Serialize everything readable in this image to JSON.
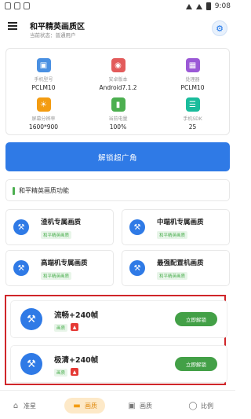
{
  "status_bar": {
    "time": "9:08"
  },
  "app_bar": {
    "title": "和平精英画质区",
    "subtitle": "当前状态：普通用户"
  },
  "device_info": [
    {
      "label": "手机型号",
      "value": "PCLM10",
      "icon": "phone-icon",
      "color": "#4a90e2"
    },
    {
      "label": "安卓版本",
      "value": "Android7.1.2",
      "icon": "android-icon",
      "color": "#e35b5b"
    },
    {
      "label": "处理器",
      "value": "PCLM10",
      "icon": "cpu-icon",
      "color": "#9b59d6"
    },
    {
      "label": "屏幕分辨率",
      "value": "1600*900",
      "icon": "screen-icon",
      "color": "#f39c12"
    },
    {
      "label": "当前电量",
      "value": "100%",
      "icon": "battery-icon",
      "color": "#4caf50"
    },
    {
      "label": "手机SDK",
      "value": "25",
      "icon": "sdk-icon",
      "color": "#1abc9c"
    }
  ],
  "unlock_main_label": "解锁超广角",
  "section_title": "和平精英画质功能",
  "quality_cards": [
    {
      "title": "渣机专属画质",
      "badge": "和平精英画质"
    },
    {
      "title": "中端机专属画质",
      "badge": "和平精英画质"
    },
    {
      "title": "高端机专属画质",
      "badge": "和平精英画质"
    },
    {
      "title": "最强配置机画质",
      "badge": "和平精英画质"
    }
  ],
  "premium_items": [
    {
      "title": "流畅+240帧",
      "badge": "画质",
      "button": "立即解锁"
    },
    {
      "title": "极清+240帧",
      "badge": "画质",
      "button": "立即解锁"
    }
  ],
  "bottom_nav": [
    {
      "label": "准星",
      "icon": "home-icon"
    },
    {
      "label": "画质",
      "icon": "quality-icon",
      "active": true
    },
    {
      "label": "画质",
      "icon": "image-icon"
    },
    {
      "label": "比例",
      "icon": "ratio-icon"
    }
  ],
  "colors": {
    "primary": "#2f7ae6",
    "accent_green": "#43a047",
    "highlight_red": "#d0262a",
    "nav_active": "#f39c12"
  }
}
